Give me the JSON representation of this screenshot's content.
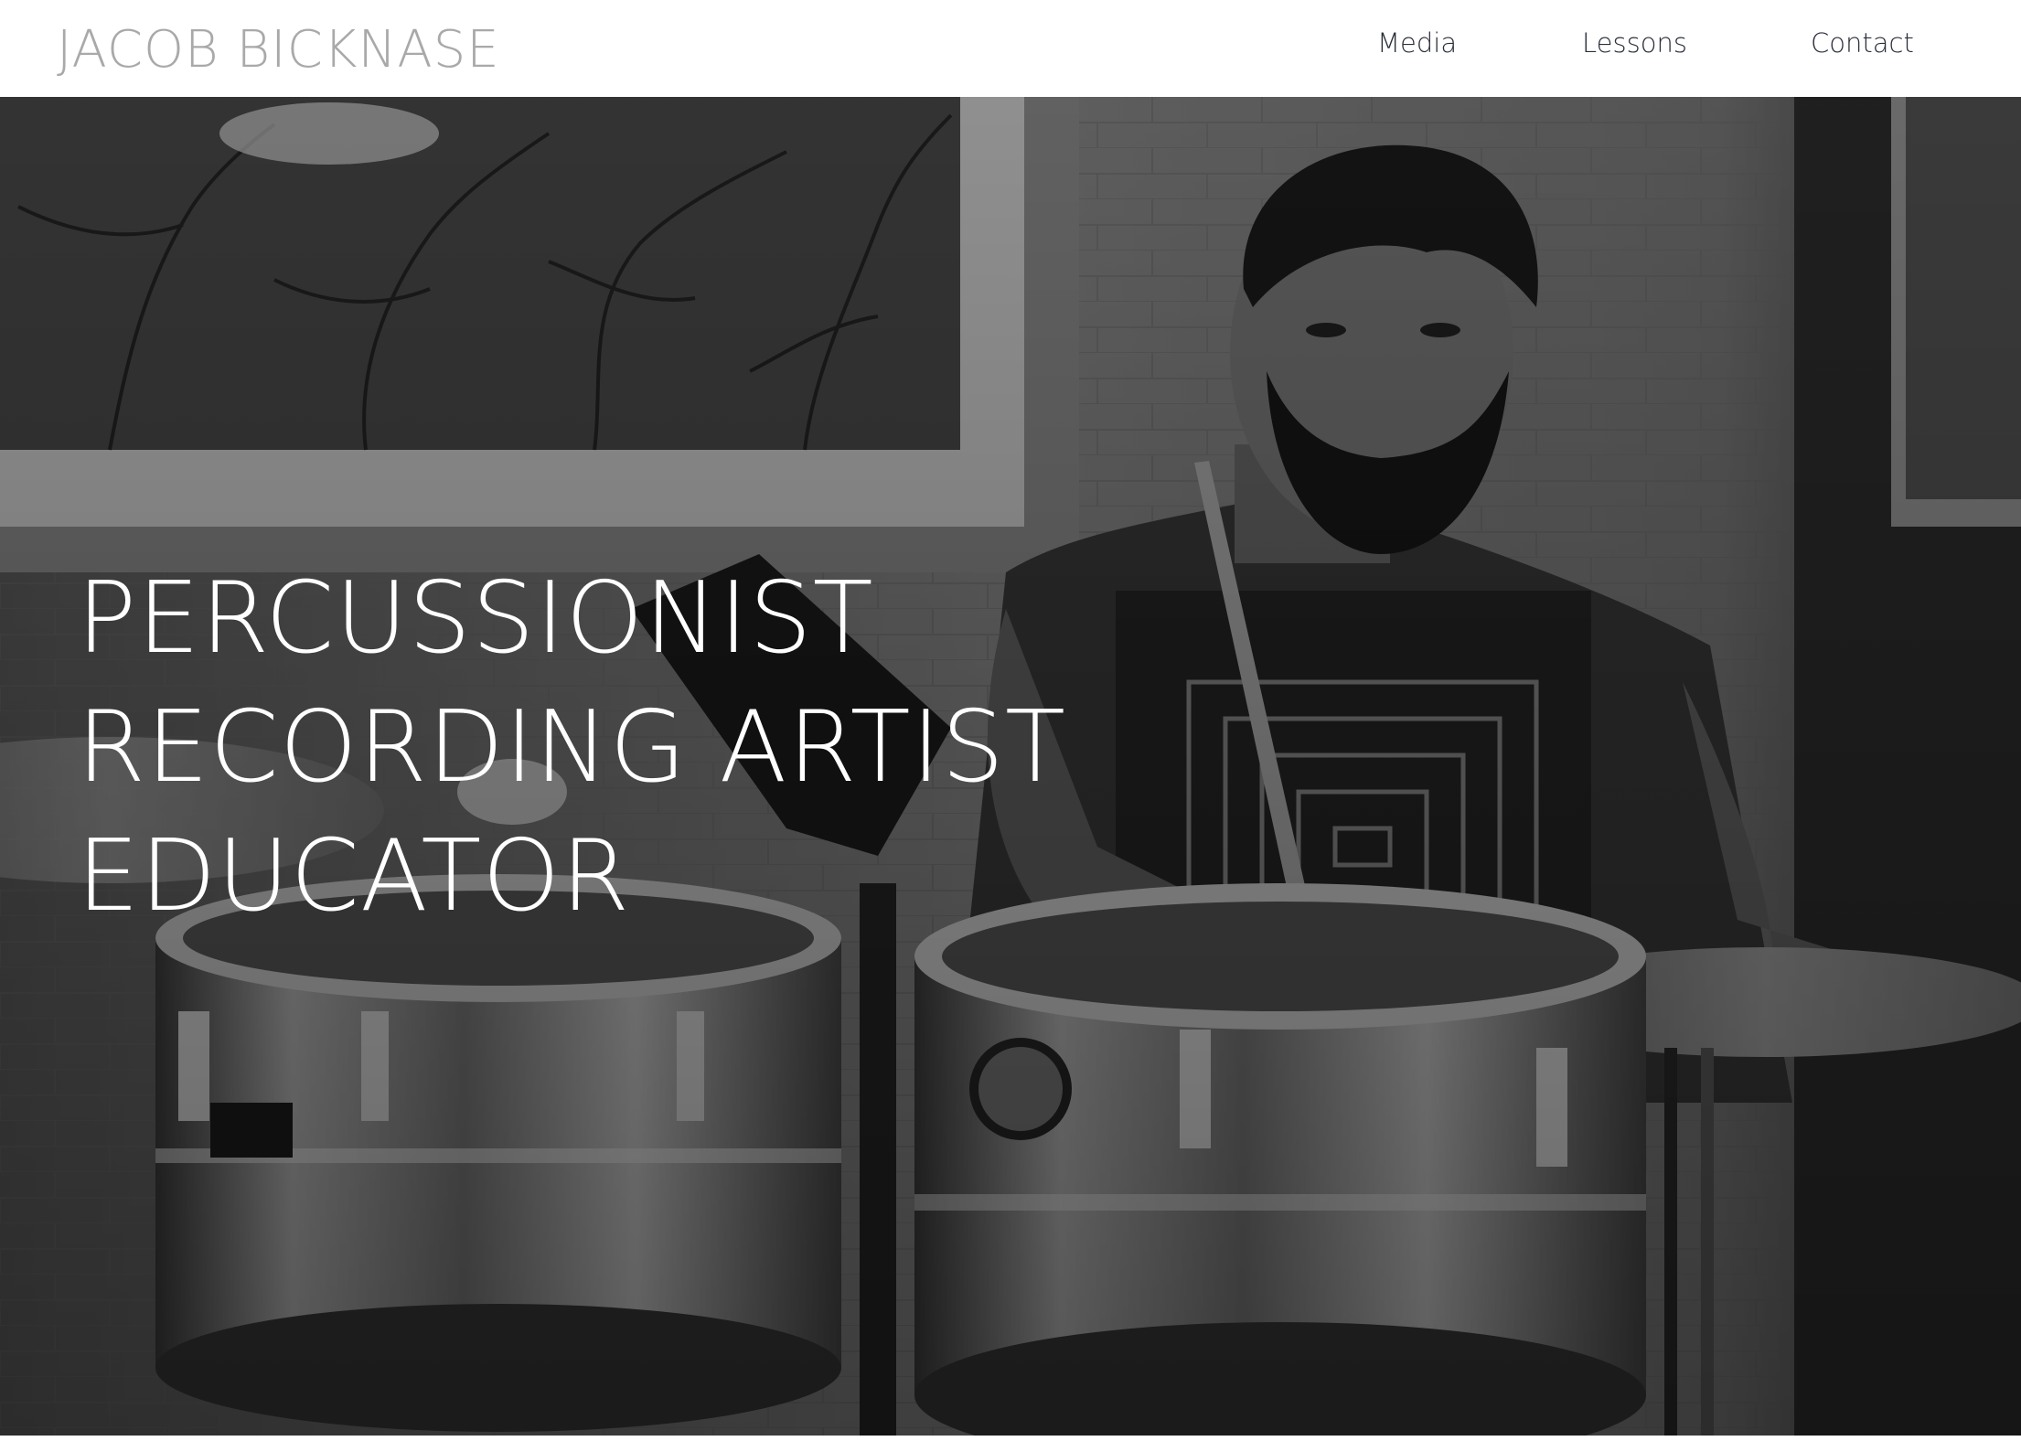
{
  "header": {
    "site_title": "JACOB BICKNASE",
    "nav": [
      {
        "label": "Media"
      },
      {
        "label": "Lessons"
      },
      {
        "label": "Contact"
      }
    ]
  },
  "hero": {
    "lines": [
      "PERCUSSIONIST",
      "RECORDING ARTIST",
      "EDUCATOR"
    ],
    "image": "black-and-white photo of a drummer playing timbales"
  },
  "colors": {
    "title": "#a9a9a9",
    "nav_text": "#2a2f3a",
    "hero_text": "#ffffff",
    "header_bg": "#ffffff"
  }
}
